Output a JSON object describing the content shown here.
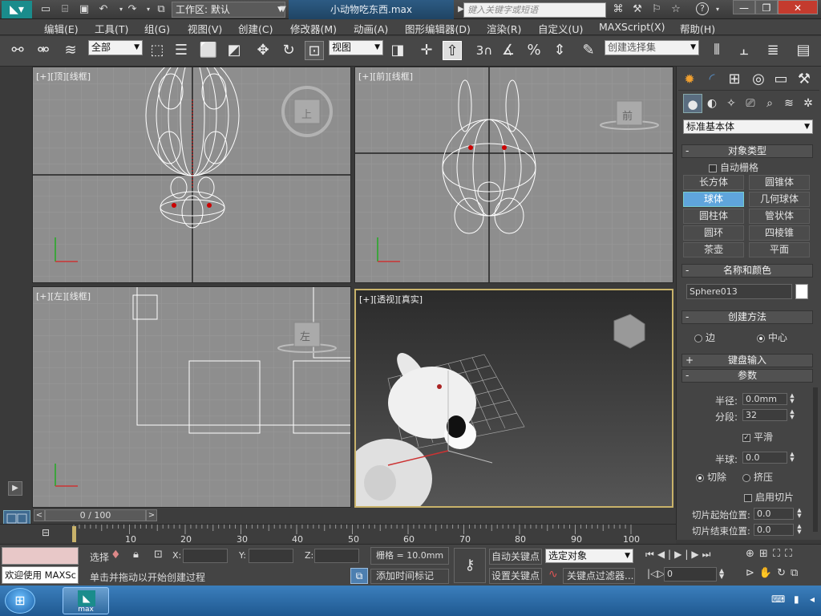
{
  "app": {
    "file_title": "小动物吃东西.max",
    "workspace": "工作区: 默认",
    "search_placeholder": "键入关键字或短语"
  },
  "menu": [
    "编辑(E)",
    "工具(T)",
    "组(G)",
    "视图(V)",
    "创建(C)",
    "修改器(M)",
    "动画(A)",
    "图形编辑器(D)",
    "渲染(R)",
    "自定义(U)",
    "MAXScript(X)",
    "帮助(H)"
  ],
  "toolbar": {
    "selection_filter": "全部",
    "ref_coord": "视图",
    "named_selection": "创建选择集",
    "snap_value": "3"
  },
  "viewports": {
    "top": {
      "label_bracket": "[+]",
      "label_view": "[顶]",
      "label_mode": "[线框]",
      "cube_label": "上"
    },
    "front": {
      "label_bracket": "[+]",
      "label_view": "[前]",
      "label_mode": "[线框]",
      "cube_label": "前"
    },
    "left": {
      "label_bracket": "[+]",
      "label_view": "[左]",
      "label_mode": "[线框]",
      "cube_label": "左"
    },
    "persp": {
      "label_bracket": "[+]",
      "label_view": "[透视]",
      "label_mode": "[真实]"
    }
  },
  "command_panel": {
    "category": "标准基本体",
    "object_type_header": "对象类型",
    "auto_grid": "自动栅格",
    "buttons": [
      "长方体",
      "圆锥体",
      "球体",
      "几何球体",
      "圆柱体",
      "管状体",
      "圆环",
      "四棱锥",
      "茶壶",
      "平面"
    ],
    "active_button": "球体",
    "name_color_header": "名称和颜色",
    "object_name": "Sphere013",
    "swatch_color": "#ffffff",
    "creation_method_header": "创建方法",
    "creation_options": [
      "边",
      "中心"
    ],
    "keyboard_input_header": "键盘输入",
    "params_header": "参数",
    "radius_label": "半径:",
    "radius_value": "0.0mm",
    "segments_label": "分段:",
    "segments_value": "32",
    "smooth_label": "平滑",
    "hemisphere_label": "半球:",
    "hemisphere_value": "0.0",
    "chop_label": "切除",
    "squash_label": "挤压",
    "enable_slice_label": "启用切片",
    "slice_from_label": "切片起始位置:",
    "slice_from_value": "0.0",
    "slice_to_label": "切片结束位置:",
    "slice_to_value": "0.0"
  },
  "timeline": {
    "frame_display": "0 / 100",
    "ticks": [
      "10",
      "20",
      "30",
      "40",
      "50",
      "60",
      "70",
      "80",
      "90",
      "100"
    ]
  },
  "status": {
    "welcome": "欢迎使用 MAXSc",
    "select_label": "选择",
    "x_label": "X:",
    "y_label": "Y:",
    "z_label": "Z:",
    "grid": "栅格 = 10.0mm",
    "prompt": "单击并拖动以开始创建过程",
    "add_time_tag": "添加时间标记",
    "auto_key": "自动关键点",
    "set_key": "设置关键点",
    "key_mode": "选定对象",
    "key_filters": "关键点过滤器...",
    "frame": "0"
  },
  "taskbar": {
    "app_label": "max"
  }
}
